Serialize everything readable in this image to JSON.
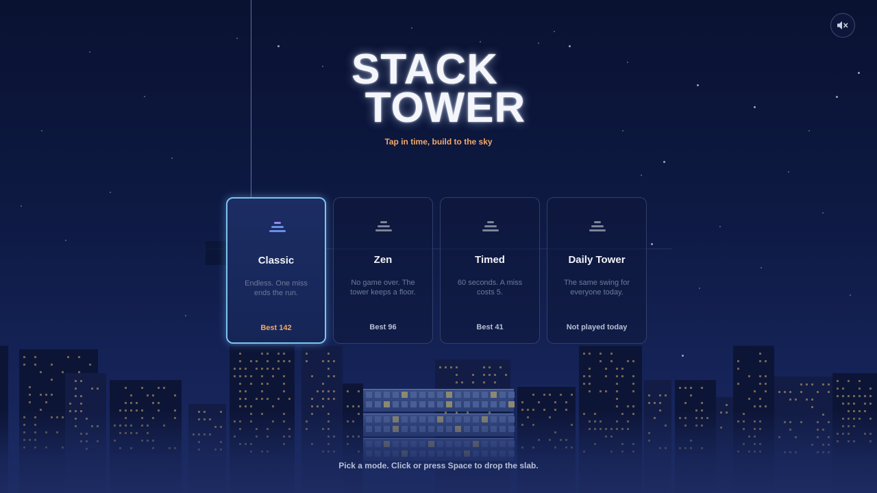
{
  "game": {
    "title_line1": "STACK",
    "title_line2": "TOWER",
    "subtitle": "Tap in time, build to the sky"
  },
  "controls": {
    "mute_icon": "speaker-muted-icon"
  },
  "modes": [
    {
      "name": "Classic",
      "description": "Endless. One miss ends the run.",
      "best": "Best 142",
      "selected": true
    },
    {
      "name": "Zen",
      "description": "No game over. The tower keeps a floor.",
      "best": "Best 96",
      "selected": false
    },
    {
      "name": "Timed",
      "description": "60 seconds. A miss costs 5.",
      "best": "Best 41",
      "selected": false
    },
    {
      "name": "Daily Tower",
      "description": "The same swing for everyone today.",
      "best": "Not played today",
      "selected": false
    }
  ],
  "footer": {
    "hint": "Pick a mode. Click or press Space to drop the slab."
  },
  "colors": {
    "accent_orange": "#f2a96a",
    "selected_border": "#7fc4f2",
    "background": "#0e1a44"
  }
}
